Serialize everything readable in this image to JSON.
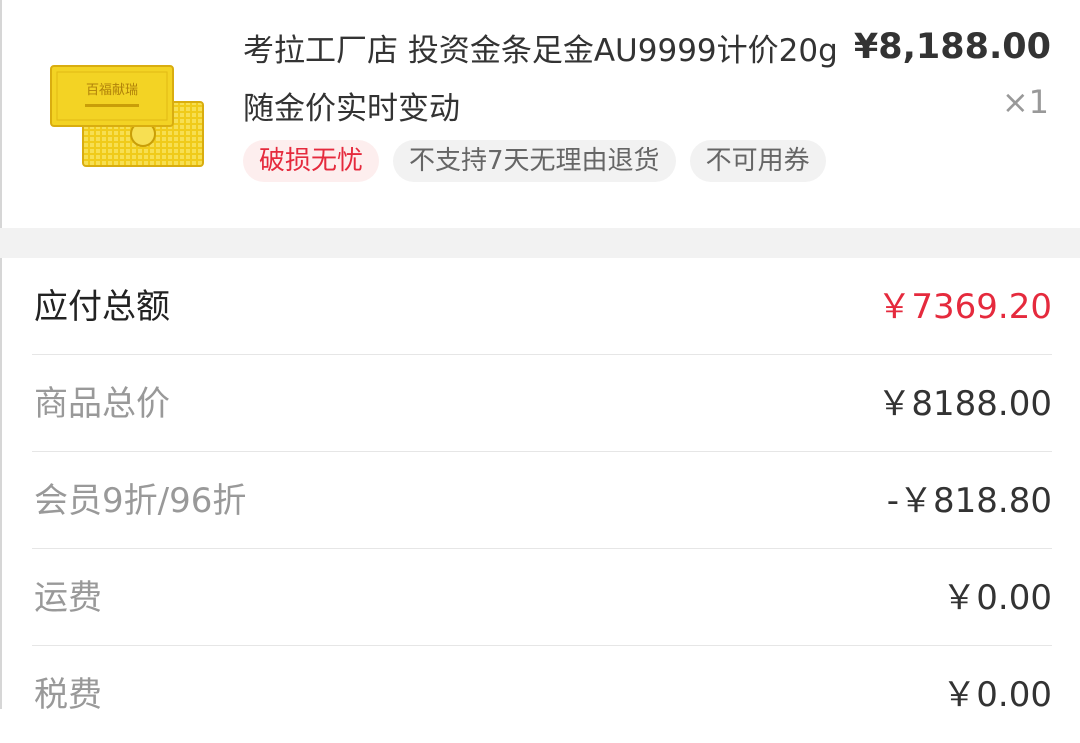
{
  "product": {
    "title": "考拉工厂店 投资金条足金AU9999计价20g 随金价实时变动",
    "price": "¥8,188.00",
    "quantity": "×1",
    "bar_engraving": "百福献瑞",
    "tags": [
      {
        "label": "破损无忧",
        "style": "red"
      },
      {
        "label": "不支持7天无理由退货",
        "style": "gray"
      },
      {
        "label": "不可用券",
        "style": "gray"
      }
    ]
  },
  "summary": {
    "rows": [
      {
        "label": "应付总额",
        "value": "￥7369.20"
      },
      {
        "label": "商品总价",
        "value": "￥8188.00"
      },
      {
        "label": "会员9折/96折",
        "value": "-￥818.80"
      },
      {
        "label": "运费",
        "value": "￥0.00"
      },
      {
        "label": "税费",
        "value": "￥0.00"
      }
    ]
  },
  "colors": {
    "accent_red": "#e52a3d",
    "gold": "#f2cf1c",
    "divider": "#e6e6e6",
    "strip": "#f2f2f2"
  }
}
